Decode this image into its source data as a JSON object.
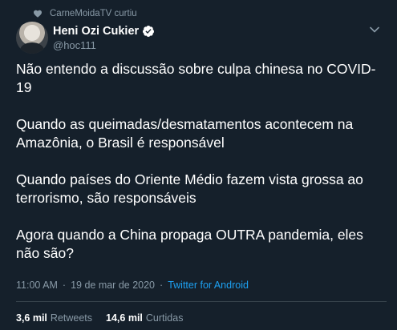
{
  "social_context": {
    "text": "CarneMoidaTV curtiu",
    "icon": "heart-icon"
  },
  "author": {
    "name": "Heni Ozi Cukier",
    "handle": "@hoc111",
    "verified": true,
    "verified_icon": "verified-badge-icon",
    "avatar": "avatar"
  },
  "menu": {
    "icon": "chevron-down-icon"
  },
  "tweet": {
    "paragraphs": [
      "Não entendo a discussão sobre culpa chinesa no COVID-19",
      "Quando as queimadas/desmatamentos acontecem na Amazônia, o Brasil é responsável",
      "Quando países do Oriente Médio fazem vista grossa ao terrorismo, são responsáveis",
      "Agora quando a China propaga OUTRA pandemia, eles não são?"
    ]
  },
  "meta": {
    "time": "11:00 AM",
    "date": "19 de mar de 2020",
    "separator": "·",
    "source": "Twitter for Android"
  },
  "stats": {
    "retweets_count": "3,6 mil",
    "retweets_label": "Retweets",
    "likes_count": "14,6 mil",
    "likes_label": "Curtidas"
  },
  "colors": {
    "background": "#15202b",
    "text_primary": "#ffffff",
    "text_secondary": "#8899a6",
    "accent": "#1da1f2",
    "divider": "#38444d"
  }
}
